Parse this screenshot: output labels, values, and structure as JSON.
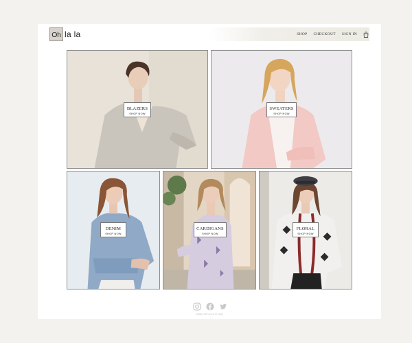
{
  "brand": {
    "logo_box": "Oh",
    "logo_rest": "la la"
  },
  "nav": {
    "shop": "SHOP",
    "checkout": "CHECKOUT",
    "signin": "SIGN IN",
    "cart_icon": "shopping-bag-icon"
  },
  "tiles": [
    {
      "category": "BLAZERS",
      "cta": "SHOP NOW"
    },
    {
      "category": "SWEATERS",
      "cta": "SHOP NOW"
    },
    {
      "category": "DENIM",
      "cta": "SHOP NOW"
    },
    {
      "category": "CARDIGANS",
      "cta": "SHOP NOW"
    },
    {
      "category": "FLORAL",
      "cta": "SHOP NOW"
    }
  ],
  "footer": {
    "icons": [
      "instagram-icon",
      "facebook-icon",
      "twitter-icon"
    ],
    "credit": "Made with love in Italy"
  },
  "colors": {
    "page_bg": "#f4f2ee",
    "icon_gray": "#c9c9c9"
  }
}
